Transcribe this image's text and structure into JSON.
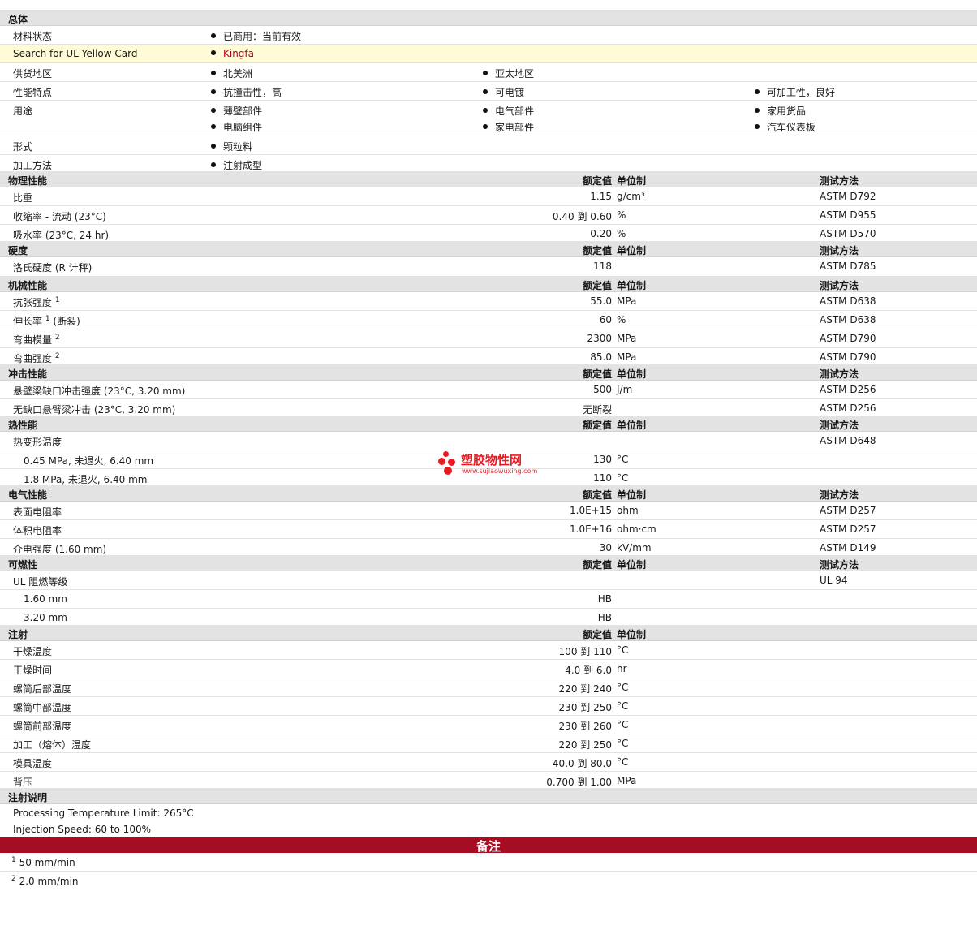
{
  "general": {
    "title": "总体",
    "material_status": {
      "label": "材料状态",
      "value": "已商用：当前有效"
    },
    "ul_search": {
      "label": "Search for UL Yellow Card",
      "value": "Kingfa"
    },
    "availability": {
      "label": "供货地区",
      "values": [
        "北美洲",
        "亚太地区"
      ]
    },
    "features": {
      "label": "性能特点",
      "values": [
        "抗撞击性，高",
        "可电镀",
        "可加工性，良好"
      ]
    },
    "uses": {
      "label": "用途",
      "values": [
        "薄壁部件",
        "电气部件",
        "家用货品",
        "电脑组件",
        "家电部件",
        "汽车仪表板"
      ]
    },
    "form": {
      "label": "形式",
      "value": "颗粒料"
    },
    "processing": {
      "label": "加工方法",
      "value": "注射成型"
    }
  },
  "col_headers": {
    "nominal": "额定值",
    "unit": "单位制",
    "method": "测试方法"
  },
  "physical": {
    "title": "物理性能",
    "rows": [
      {
        "label": "比重",
        "value": "1.15",
        "unit": "g/cm³",
        "method": "ASTM D792"
      },
      {
        "label": "收缩率 - 流动 (23°C)",
        "value": "0.40 到  0.60",
        "unit": "%",
        "method": "ASTM D955"
      },
      {
        "label": "吸水率 (23°C, 24 hr)",
        "value": "0.20",
        "unit": "%",
        "method": "ASTM D570"
      }
    ]
  },
  "hardness": {
    "title": "硬度",
    "rows": [
      {
        "label": "洛氏硬度 (R 计秤)",
        "value": "118",
        "unit": "",
        "method": "ASTM D785"
      }
    ]
  },
  "mechanical": {
    "title": "机械性能",
    "rows": [
      {
        "label": "抗张强度",
        "sup": "1",
        "suffix": "",
        "value": "55.0",
        "unit": "MPa",
        "method": "ASTM D638"
      },
      {
        "label": "伸长率",
        "sup": "1",
        "suffix": " (断裂)",
        "value": "60",
        "unit": "%",
        "method": "ASTM D638"
      },
      {
        "label": "弯曲模量",
        "sup": "2",
        "suffix": "",
        "value": "2300",
        "unit": "MPa",
        "method": "ASTM D790"
      },
      {
        "label": "弯曲强度",
        "sup": "2",
        "suffix": "",
        "value": "85.0",
        "unit": "MPa",
        "method": "ASTM D790"
      }
    ]
  },
  "impact": {
    "title": "冲击性能",
    "rows": [
      {
        "label": "悬壁梁缺口冲击强度 (23°C, 3.20 mm)",
        "value": "500",
        "unit": "J/m",
        "method": "ASTM D256"
      },
      {
        "label": "无缺口悬臂梁冲击 (23°C, 3.20 mm)",
        "value": "无断裂",
        "unit": "",
        "method": "ASTM D256"
      }
    ]
  },
  "thermal": {
    "title": "热性能",
    "rows": [
      {
        "label": "热变形温度",
        "value": "",
        "unit": "",
        "method": "ASTM D648"
      },
      {
        "label": "0.45 MPa, 未退火, 6.40 mm",
        "value": "130",
        "unit": "°C",
        "method": ""
      },
      {
        "label": "1.8 MPa, 未退火, 6.40 mm",
        "value": "110",
        "unit": "°C",
        "method": ""
      }
    ]
  },
  "electrical": {
    "title": "电气性能",
    "rows": [
      {
        "label": "表面电阻率",
        "value": "1.0E+15",
        "unit": "ohm",
        "method": "ASTM D257"
      },
      {
        "label": "体积电阻率",
        "value": "1.0E+16",
        "unit": "ohm·cm",
        "method": "ASTM D257"
      },
      {
        "label": "介电强度 (1.60 mm)",
        "value": "30",
        "unit": "kV/mm",
        "method": "ASTM D149"
      }
    ]
  },
  "flammability": {
    "title": "可燃性",
    "rows": [
      {
        "label": "UL 阻燃等级",
        "value": "",
        "unit": "",
        "method": "UL 94"
      },
      {
        "label": "1.60 mm",
        "value": "HB",
        "unit": "",
        "method": ""
      },
      {
        "label": "3.20 mm",
        "value": "HB",
        "unit": "",
        "method": ""
      }
    ]
  },
  "injection": {
    "title": "注射",
    "rows": [
      {
        "label": "干燥温度",
        "value": "100 到  110",
        "unit": "°C"
      },
      {
        "label": "干燥时间",
        "value": "4.0 到  6.0",
        "unit": "hr"
      },
      {
        "label": "螺筒后部温度",
        "value": "220 到  240",
        "unit": "°C"
      },
      {
        "label": "螺筒中部温度",
        "value": "230 到  250",
        "unit": "°C"
      },
      {
        "label": "螺筒前部温度",
        "value": "230 到  260",
        "unit": "°C"
      },
      {
        "label": "加工（熔体）温度",
        "value": "220 到  250",
        "unit": "°C"
      },
      {
        "label": "模具温度",
        "value": "40.0 到  80.0",
        "unit": "°C"
      },
      {
        "label": "背压",
        "value": "0.700 到  1.00",
        "unit": "MPa"
      }
    ]
  },
  "injection_notes": {
    "title": "注射说明",
    "lines": [
      "Processing Temperature Limit: 265°C",
      "Injection Speed: 60 to 100%"
    ]
  },
  "notes": {
    "title": "备注",
    "items": [
      {
        "num": "1",
        "text": "50 mm/min"
      },
      {
        "num": "2",
        "text": "2.0 mm/min"
      }
    ]
  },
  "watermark": {
    "cn": "塑胶物性网",
    "url": "www.sujiaowuxing.com"
  },
  "colors": {
    "section_bg": "#e3e3e3",
    "highlight_bg": "#fffbd6",
    "link_red": "#b3001b",
    "notes_bar": "#a50d22"
  }
}
